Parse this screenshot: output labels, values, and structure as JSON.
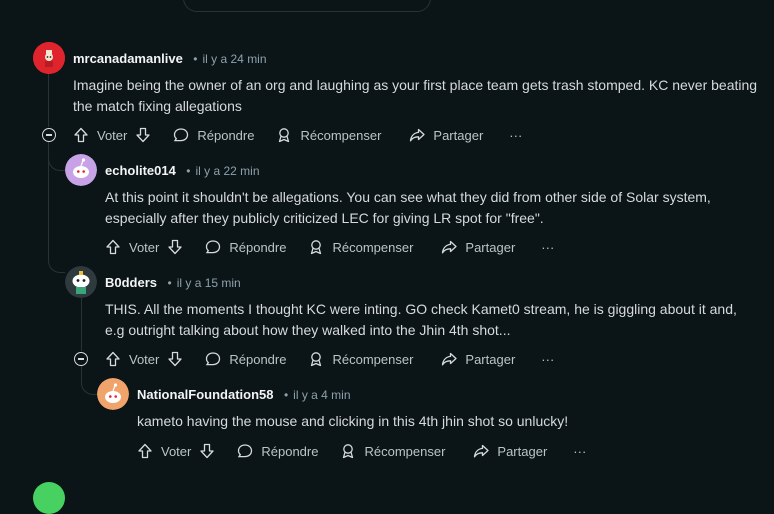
{
  "colors": {
    "background": "#0b1416",
    "text": "#d7dadc",
    "meta": "#8ba2ad",
    "thread_line": "#2a3236",
    "avatar_red": "#e0242e",
    "avatar_purple": "#c8a2e6",
    "avatar_orange": "#f0a36b"
  },
  "actions": {
    "vote": "Voter",
    "reply": "Répondre",
    "award": "Récompenser",
    "share": "Partager",
    "more": "···"
  },
  "comments": [
    {
      "username": "mrcanadamanlive",
      "time": "il y a 24 min",
      "text": "Imagine being the owner of an org and laughing as your first place team gets trash stomped. KC never beating the match fixing allegations"
    },
    {
      "username": "echolite014",
      "time": "il y a 22 min",
      "text": "At this point it shouldn't be allegations. You can see what they did from other side of Solar system, especially after they publicly criticized LEC for giving LR spot for \"free\"."
    },
    {
      "username": "B0dders",
      "time": "il y a 15 min",
      "text": "THIS. All the moments I thought KC were inting. GO check Kamet0 stream, he is giggling about it and, e.g outright talking about how they walked into the Jhin 4th shot..."
    },
    {
      "username": "NationalFoundation58",
      "time": "il y a 4 min",
      "text": "kameto having the mouse and clicking in this 4th jhin shot so unlucky!"
    }
  ]
}
